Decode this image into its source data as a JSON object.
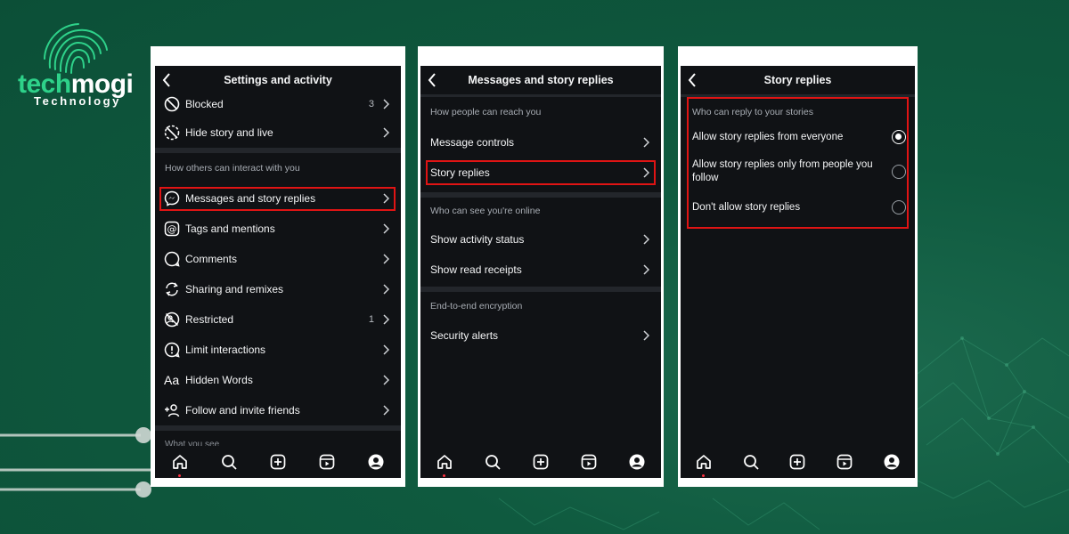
{
  "brand": {
    "logo_part1": "tech",
    "logo_part2": "mogi",
    "tagline": "Technology",
    "primary_color": "#2ed28a",
    "background_color": "#0c4f37",
    "highlight_color": "#e01414"
  },
  "screen1": {
    "title": "Settings and activity",
    "top_rows": [
      {
        "label": "Blocked",
        "count": "3",
        "icon": "blocked-icon"
      },
      {
        "label": "Hide story and live",
        "icon": "hide-story-icon"
      }
    ],
    "section_label": "How others can interact with you",
    "rows": [
      {
        "label": "Messages and story replies",
        "icon": "messenger-icon",
        "highlighted": true
      },
      {
        "label": "Tags and mentions",
        "icon": "at-icon"
      },
      {
        "label": "Comments",
        "icon": "comment-icon"
      },
      {
        "label": "Sharing and remixes",
        "icon": "remix-icon"
      },
      {
        "label": "Restricted",
        "count": "1",
        "icon": "restricted-icon"
      },
      {
        "label": "Limit interactions",
        "icon": "limit-icon"
      },
      {
        "label": "Hidden Words",
        "icon": "text-aa-icon"
      },
      {
        "label": "Follow and invite friends",
        "icon": "add-person-icon"
      }
    ],
    "cut_section_label": "What you see"
  },
  "screen2": {
    "title": "Messages and story replies",
    "section1_label": "How people can reach you",
    "section1_rows": [
      {
        "label": "Message controls"
      },
      {
        "label": "Story replies",
        "highlighted": true
      }
    ],
    "section2_label": "Who can see you're online",
    "section2_rows": [
      {
        "label": "Show activity status"
      },
      {
        "label": "Show read receipts"
      }
    ],
    "section3_label": "End-to-end encryption",
    "section3_rows": [
      {
        "label": "Security alerts"
      }
    ]
  },
  "screen3": {
    "title": "Story replies",
    "section_label": "Who can reply to your stories",
    "options": [
      {
        "label": "Allow story replies from everyone",
        "selected": true
      },
      {
        "label": "Allow story replies only from people you follow",
        "selected": false
      },
      {
        "label": "Don't allow story replies",
        "selected": false
      }
    ]
  },
  "tabbar": {
    "icons": [
      "home-icon",
      "search-icon",
      "create-icon",
      "reels-icon",
      "profile-icon"
    ],
    "active": "home-icon"
  }
}
